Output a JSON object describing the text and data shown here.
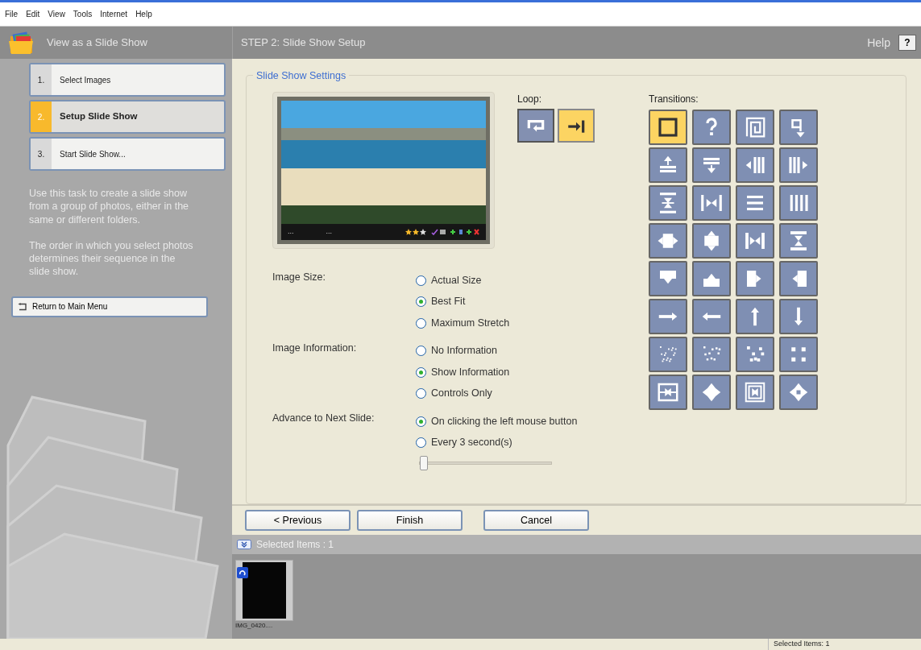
{
  "menu": [
    "File",
    "Edit",
    "View",
    "Tools",
    "Internet",
    "Help"
  ],
  "task_header": {
    "title": "View as a Slide Show"
  },
  "step_header": {
    "title": "STEP 2: Slide Show Setup",
    "help": "Help",
    "help_button": "?"
  },
  "steps": [
    {
      "number": "1.",
      "label": "Select Images",
      "selected": false
    },
    {
      "number": "2.",
      "label": "Setup Slide Show",
      "selected": true
    },
    {
      "number": "3.",
      "label": "Start Slide Show...",
      "selected": false
    }
  ],
  "description": [
    "Use this task to create a slide show from a group of photos, either in the same or different folders.",
    "The order in which you select photos determines their sequence in the slide show."
  ],
  "return_button": "Return to Main Menu",
  "settings": {
    "title": "Slide Show Settings",
    "preview": {
      "info_left": "...",
      "info_middle": "...",
      "stars": 2
    },
    "loop": {
      "label": "Loop:",
      "options": [
        {
          "kind": "loop",
          "selected": false
        },
        {
          "kind": "stop",
          "selected": true
        }
      ]
    },
    "transitions": {
      "label": "Transitions:",
      "items": [
        {
          "kind": "none",
          "selected": true
        },
        {
          "kind": "random",
          "selected": false
        },
        {
          "kind": "spiral",
          "selected": false
        },
        {
          "kind": "snake",
          "selected": false
        },
        {
          "kind": "wipe-up",
          "selected": false
        },
        {
          "kind": "wipe-down",
          "selected": false
        },
        {
          "kind": "wipe-left",
          "selected": false
        },
        {
          "kind": "wipe-right",
          "selected": false
        },
        {
          "kind": "split-vertical",
          "selected": false
        },
        {
          "kind": "split-horizontal",
          "selected": false
        },
        {
          "kind": "blinds-horizontal",
          "selected": false
        },
        {
          "kind": "blinds-vertical",
          "selected": false
        },
        {
          "kind": "expand-horizontal",
          "selected": false
        },
        {
          "kind": "expand-vertical",
          "selected": false
        },
        {
          "kind": "contract-horizontal",
          "selected": false
        },
        {
          "kind": "contract-vertical",
          "selected": false
        },
        {
          "kind": "slide-down",
          "selected": false
        },
        {
          "kind": "slide-up",
          "selected": false
        },
        {
          "kind": "slide-right",
          "selected": false
        },
        {
          "kind": "slide-left",
          "selected": false
        },
        {
          "kind": "push-right",
          "selected": false
        },
        {
          "kind": "push-left",
          "selected": false
        },
        {
          "kind": "push-up",
          "selected": false
        },
        {
          "kind": "push-down",
          "selected": false
        },
        {
          "kind": "dissolve-fine",
          "selected": false
        },
        {
          "kind": "dissolve-small",
          "selected": false
        },
        {
          "kind": "dissolve-medium",
          "selected": false
        },
        {
          "kind": "dissolve-large",
          "selected": false
        },
        {
          "kind": "box-horizontal",
          "selected": false
        },
        {
          "kind": "explode",
          "selected": false
        },
        {
          "kind": "box-in",
          "selected": false
        },
        {
          "kind": "box-out",
          "selected": false
        }
      ]
    },
    "groups": [
      {
        "label": "Image Size:",
        "options": [
          {
            "label": "Actual Size",
            "selected": false
          },
          {
            "label": "Best Fit",
            "selected": true
          },
          {
            "label": "Maximum Stretch",
            "selected": false
          }
        ]
      },
      {
        "label": "Image Information:",
        "options": [
          {
            "label": "No Information",
            "selected": false
          },
          {
            "label": "Show Information",
            "selected": true
          },
          {
            "label": "Controls Only",
            "selected": false
          }
        ]
      },
      {
        "label": "Advance to Next Slide:",
        "options": [
          {
            "label": "On clicking the left mouse button",
            "selected": true
          },
          {
            "label": "Every 3 second(s)",
            "selected": false
          }
        ],
        "slider": {
          "level": 0.03
        }
      }
    ]
  },
  "buttons": [
    "< Previous",
    "Finish",
    "Cancel"
  ],
  "selected_items": {
    "title": "Selected Items : 1",
    "items": [
      {
        "label": "IMG_0420...."
      }
    ]
  },
  "status_bar": "Selected Items: 1"
}
